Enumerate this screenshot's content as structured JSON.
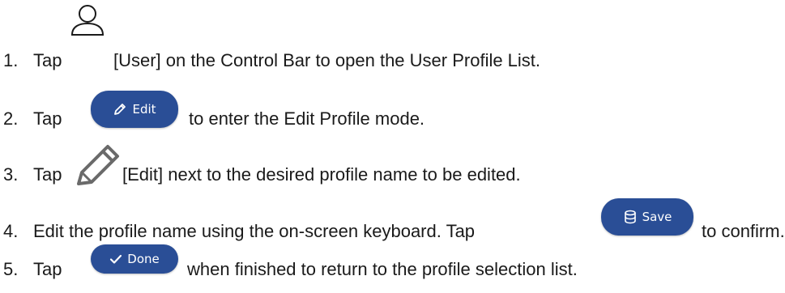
{
  "accent_color": "#2a4e96",
  "steps": [
    {
      "number": "1.",
      "pre": "Tap",
      "icon": "user-icon",
      "post": "[User] on the Control Bar to open the User Profile List."
    },
    {
      "number": "2.",
      "pre": "Tap",
      "button": {
        "label": "Edit",
        "icon": "pencil-icon"
      },
      "post": "to enter the Edit Profile mode."
    },
    {
      "number": "3.",
      "pre": "Tap",
      "icon": "pencil-icon",
      "post": "[Edit] next to the desired profile name to be edited."
    },
    {
      "number": "4.",
      "pre": "Edit the profile name using the on-screen keyboard. Tap",
      "button": {
        "label": "Save",
        "icon": "database-icon"
      },
      "post": "to confirm."
    },
    {
      "number": "5.",
      "pre": "Tap",
      "button": {
        "label": "Done",
        "icon": "check-icon"
      },
      "post": "when finished to return to the profile selection list."
    }
  ]
}
